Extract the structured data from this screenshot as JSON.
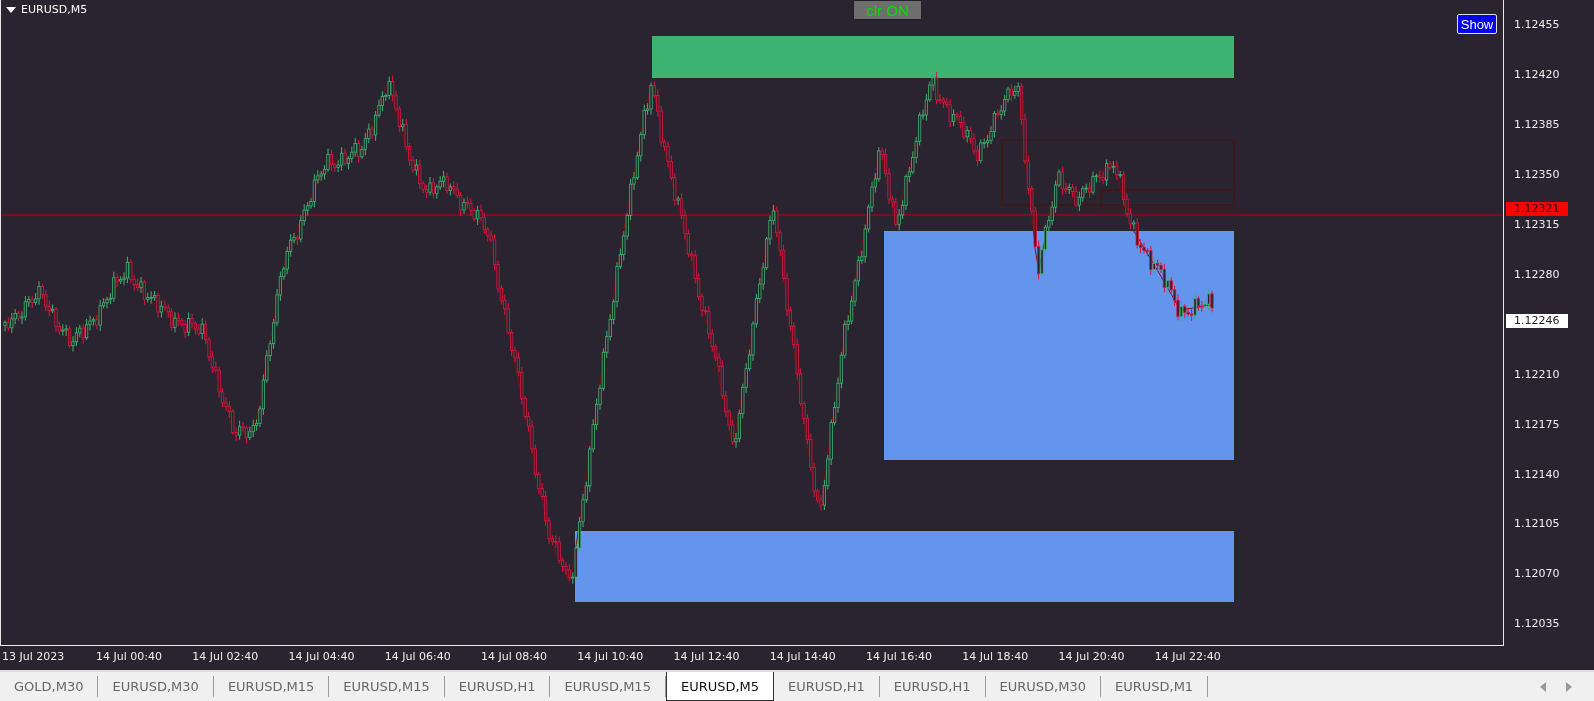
{
  "chart": {
    "symbol": "EURUSD,M5",
    "toggle_button": "clr ON",
    "show_button": "Show",
    "price_scale": [
      "1.12455",
      "1.12420",
      "1.12385",
      "1.12350",
      "1.12315",
      "1.12280",
      "1.12210",
      "1.12175",
      "1.12140",
      "1.12105",
      "1.12070",
      "1.12035"
    ],
    "price_markers": [
      {
        "kind": "bid",
        "label": "1.12321"
      },
      {
        "kind": "last",
        "label": "1.12246"
      }
    ],
    "time_scale": [
      "13 Jul 2023",
      "14 Jul 00:40",
      "14 Jul 02:40",
      "14 Jul 04:40",
      "14 Jul 06:40",
      "14 Jul 08:40",
      "14 Jul 10:40",
      "14 Jul 12:40",
      "14 Jul 14:40",
      "14 Jul 16:40",
      "14 Jul 18:40",
      "14 Jul 20:40",
      "14 Jul 22:40"
    ]
  },
  "tabs": [
    {
      "label": "GOLD,M30",
      "selected": false
    },
    {
      "label": "EURUSD,M30",
      "selected": false
    },
    {
      "label": "EURUSD,M15",
      "selected": false
    },
    {
      "label": "EURUSD,M15",
      "selected": false
    },
    {
      "label": "EURUSD,H1",
      "selected": false
    },
    {
      "label": "EURUSD,M15",
      "selected": false
    },
    {
      "label": "EURUSD,M5",
      "selected": true
    },
    {
      "label": "EURUSD,H1",
      "selected": false
    },
    {
      "label": "EURUSD,H1",
      "selected": false
    },
    {
      "label": "EURUSD,M30",
      "selected": false
    },
    {
      "label": "EURUSD,M1",
      "selected": false
    }
  ]
}
